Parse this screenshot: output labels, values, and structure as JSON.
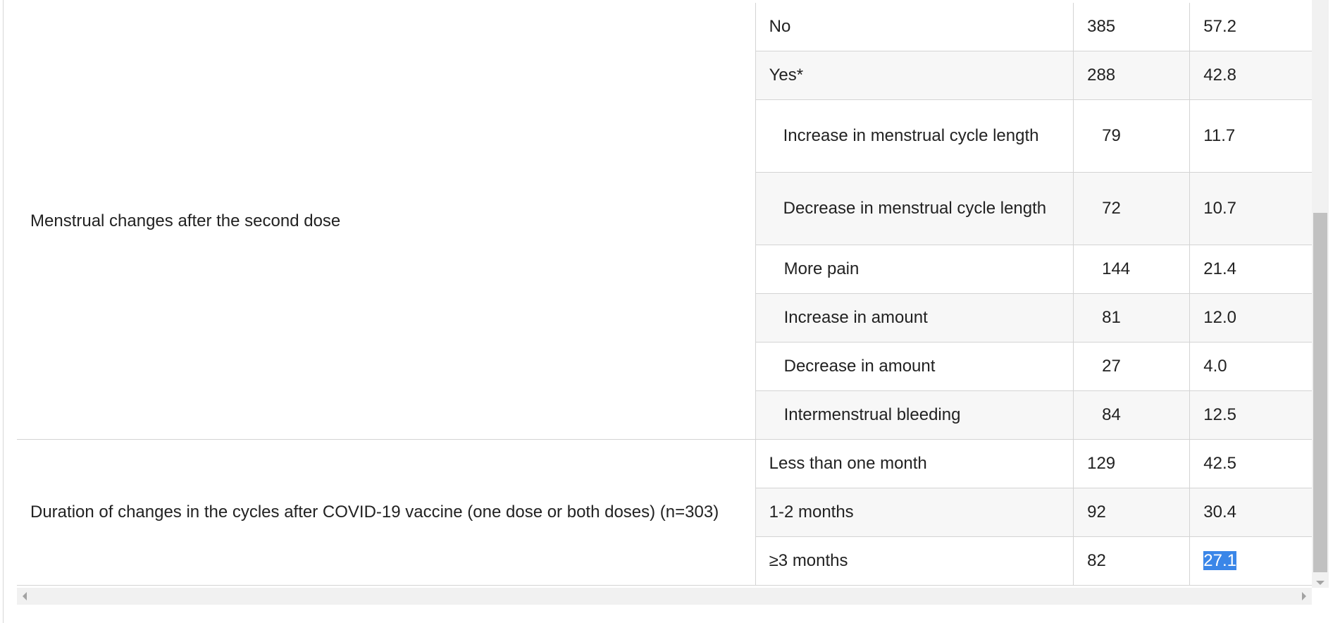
{
  "groups": [
    {
      "label": "Menstrual changes after the second dose",
      "rows": [
        {
          "label": "No",
          "n": "385",
          "pct": "57.2"
        },
        {
          "label": "Yes*",
          "n": "288",
          "pct": "42.8"
        },
        {
          "label": "Increase in menstrual cycle length",
          "n": "79",
          "pct": "11.7"
        },
        {
          "label": "Decrease in menstrual cycle length",
          "n": "72",
          "pct": "10.7"
        },
        {
          "label": "More pain",
          "n": "144",
          "pct": "21.4"
        },
        {
          "label": "Increase in amount",
          "n": "81",
          "pct": "12.0"
        },
        {
          "label": "Decrease in amount",
          "n": "27",
          "pct": "4.0"
        },
        {
          "label": "Intermenstrual bleeding",
          "n": "84",
          "pct": "12.5"
        }
      ]
    },
    {
      "label": "Duration of changes in the cycles after COVID-19 vaccine (one dose or both doses) (n=303)",
      "rows": [
        {
          "label": "Less than one month",
          "n": "129",
          "pct": "42.5"
        },
        {
          "label": "1-2 months",
          "n": "92",
          "pct": "30.4"
        },
        {
          "label": "≥3 months",
          "n": "82",
          "pct": "27.1"
        }
      ]
    }
  ],
  "selection": {
    "highlight_color": "#3a86e8"
  }
}
